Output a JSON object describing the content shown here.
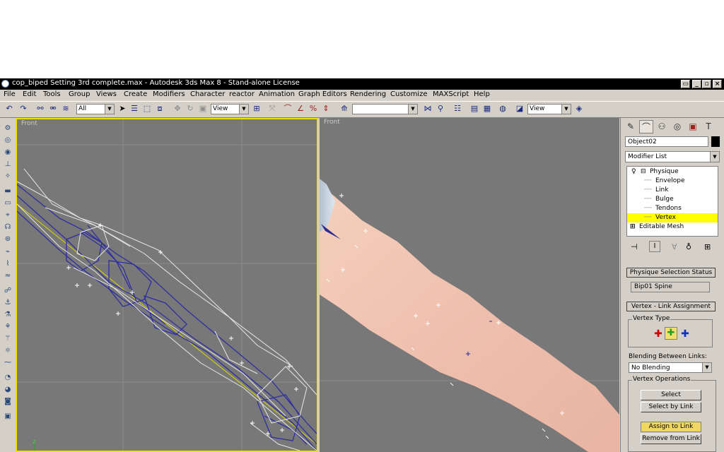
{
  "window": {
    "title": "cop_biped Setting 3rd complete.max - Autodesk 3ds Max 8  - Stand-alone License"
  },
  "menu": [
    "File",
    "Edit",
    "Tools",
    "Group",
    "Views",
    "Create",
    "Modifiers",
    "Character",
    "reactor",
    "Animation",
    "Graph Editors",
    "Rendering",
    "Customize",
    "MAXScript",
    "Help"
  ],
  "toolbar": {
    "selection_filter": "All",
    "ref_coord": "View",
    "named_selection": "",
    "view_mode": "View"
  },
  "viewports": {
    "left_label": "Front",
    "right_label": "Front",
    "axis_z": "z",
    "axis_x": "x"
  },
  "command_panel": {
    "object_name": "Object02",
    "modifier_list": "Modifier List",
    "stack": {
      "physique": "Physique",
      "envelope": "Envelope",
      "link": "Link",
      "bulge": "Bulge",
      "tendons": "Tendons",
      "vertex": "Vertex",
      "editable_mesh": "Editable Mesh"
    },
    "physique_selection_status": {
      "title": "Physique Selection Status",
      "value": "Bip01 Spine"
    },
    "vertex_link_assignment": {
      "title": "Vertex - Link Assignment",
      "vertex_type_label": "Vertex Type",
      "blending_label": "Blending Between Links:",
      "blending_value": "No Blending",
      "vertex_ops_label": "Vertex Operations",
      "select": "Select",
      "select_by_link": "Select by Link",
      "assign_to_link": "Assign to Link",
      "remove_from_link": "Remove from Link"
    }
  },
  "colors": {
    "titlebar": "#000000",
    "active_viewport_border": "#f0e000",
    "selected_stack_item": "#ffff00",
    "viewport_bg": "#787878",
    "skin": "#f0c4b0",
    "wire_blue": "#3030a0"
  }
}
